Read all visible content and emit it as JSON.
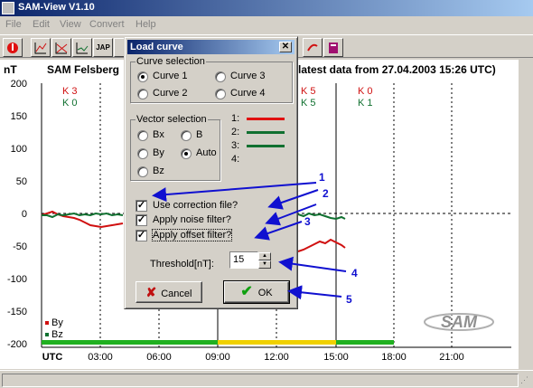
{
  "app": {
    "title": "SAM-View V1.10"
  },
  "menu": [
    "File",
    "Edit",
    "View",
    "Convert",
    "Help"
  ],
  "toolbar": {
    "buttons_left": [
      "exit-icon",
      "chart-icon",
      "chart-icon",
      "chart-icon",
      "jap-icon"
    ],
    "jap_label": "JAP",
    "buttons_right": [
      "pen-icon",
      "book-icon"
    ]
  },
  "plot": {
    "unit": "nT",
    "title_left": "SAM Felsberg",
    "title_right": "latest data from 27.04.2003 15:26 UTC)",
    "y_ticks": [
      "200",
      "150",
      "100",
      "50",
      "0",
      "-50",
      "-100",
      "-150",
      "-200"
    ],
    "x_ticks": [
      "UTC",
      "03:00",
      "06:00",
      "09:00",
      "12:00",
      "15:00",
      "18:00",
      "21:00"
    ],
    "k_top": [
      "K 3",
      "K 5",
      "K 0"
    ],
    "k_bottom": [
      "K 0",
      "K 5",
      "K 1"
    ],
    "legend": [
      "By",
      "Bz"
    ],
    "colors": {
      "By": "#d01010",
      "Bz": "#107030",
      "ok": "#20b020",
      "warn": "#f0d000"
    },
    "watermark": "SAM"
  },
  "dialog": {
    "title": "Load curve",
    "curve_selection": {
      "label": "Curve selection",
      "options": [
        "Curve 1",
        "Curve 2",
        "Curve 3",
        "Curve 4"
      ],
      "selected": "Curve 1"
    },
    "vector_selection": {
      "label": "Vector selection",
      "options": [
        "Bx",
        "By",
        "Bz",
        "B",
        "Auto"
      ],
      "selected": "Auto"
    },
    "curve_legend": [
      {
        "label": "1:",
        "color": "#e01010"
      },
      {
        "label": "2:",
        "color": "#107030"
      },
      {
        "label": "3:",
        "color": "#107030"
      },
      {
        "label": "4:",
        "color": ""
      }
    ],
    "checkboxes": [
      {
        "label": "Use correction file?",
        "checked": true
      },
      {
        "label": "Apply noise filter?",
        "checked": true
      },
      {
        "label": "Apply offset filter?",
        "checked": true
      }
    ],
    "threshold": {
      "label": "Threshold[nT]:",
      "value": "15"
    },
    "cancel_label": "Cancel",
    "ok_label": "OK"
  },
  "annotations": [
    "1",
    "2",
    "3",
    "4",
    "5"
  ]
}
